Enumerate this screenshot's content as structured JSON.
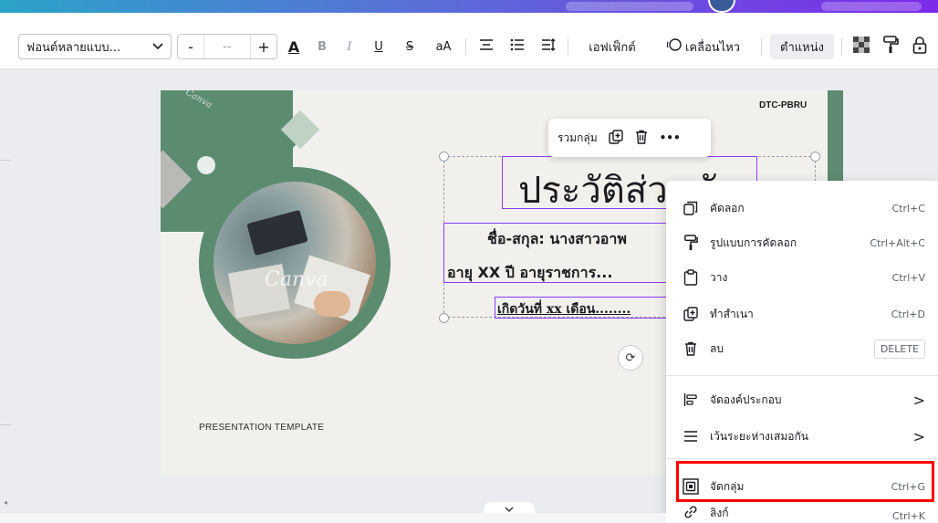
{
  "toolbar": {
    "font_name": "ฟอนต์หลายแบบ...",
    "size_minus": "-",
    "size_value": "--",
    "size_plus": "+",
    "text_color": "A",
    "bold": "B",
    "italic": "I",
    "underline": "U",
    "strike": "S",
    "case": "aA",
    "effects_label": "เอฟเฟ็กต์",
    "animate_label": "เคลื่อนไหว",
    "position_label": "ตำแหน่ง"
  },
  "float_toolbar": {
    "group_label": "รวมกลุ่ม",
    "more": "•••"
  },
  "slide": {
    "dtc_label": "DTC-PBRU",
    "title": "ประวัติส่วนตัว",
    "name_line": "ชื่อ-สกุล: นางสาวอาพ",
    "age_line": "อายุ  XX  ปี อายุราชการ...",
    "birth_line": "เกิดวันที่ xx เดือน........",
    "presentation_label": "PRESENTATION TEMPLATE",
    "watermark": "Canva",
    "watermark_small": "Canva",
    "rotate_symbol": "⟳"
  },
  "context_menu": {
    "items": [
      {
        "label": "คัดลอก",
        "shortcut": "Ctrl+C",
        "icon": "copy-icon"
      },
      {
        "label": "รูปแบบการคัดลอก",
        "shortcut": "Ctrl+Alt+C",
        "icon": "paint-roller-icon"
      },
      {
        "label": "วาง",
        "shortcut": "Ctrl+V",
        "icon": "clipboard-icon"
      },
      {
        "label": "ทำสำเนา",
        "shortcut": "Ctrl+D",
        "icon": "duplicate-icon"
      },
      {
        "label": "ลบ",
        "shortcut": "DELETE",
        "icon": "trash-icon"
      },
      {
        "label": "จัดองค์ประกอบ",
        "shortcut": ">",
        "icon": "align-icon"
      },
      {
        "label": "เว้นระยะห่างเสมอกัน",
        "shortcut": ">",
        "icon": "spacing-icon"
      },
      {
        "label": "จัดกลุ่ม",
        "shortcut": "Ctrl+G",
        "icon": "group-icon"
      },
      {
        "label": "ลิงก์",
        "shortcut": "Ctrl+K",
        "icon": "link-icon"
      }
    ]
  },
  "colors": {
    "accent_purple": "#8b3dff",
    "slide_green": "#5b8c6f",
    "highlight_red": "#ff0000"
  }
}
